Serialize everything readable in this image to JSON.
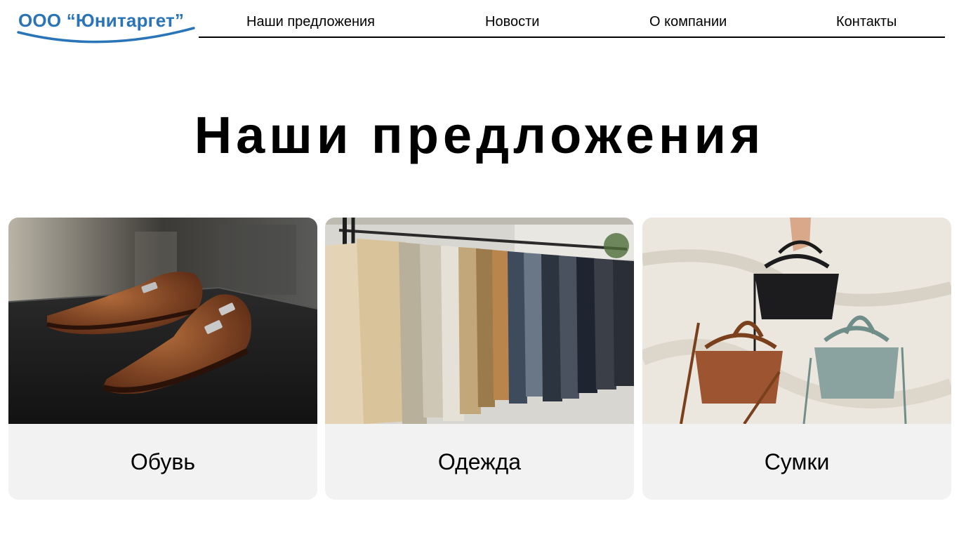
{
  "logo": {
    "text": "ООО “Юнитаргет”",
    "color": "#2a74b8"
  },
  "nav": {
    "items": [
      {
        "label": "Наши предложения"
      },
      {
        "label": "Новости"
      },
      {
        "label": "О компании"
      },
      {
        "label": "Контакты"
      }
    ]
  },
  "page": {
    "title": "Наши предложения"
  },
  "cards": [
    {
      "label": "Обувь",
      "image": "shoes-photo"
    },
    {
      "label": "Одежда",
      "image": "clothes-rack-photo"
    },
    {
      "label": "Сумки",
      "image": "handbags-photo"
    }
  ],
  "colors": {
    "card_bg": "#f2f2f2",
    "nav_line": "#000000",
    "brand": "#2a74b8"
  }
}
